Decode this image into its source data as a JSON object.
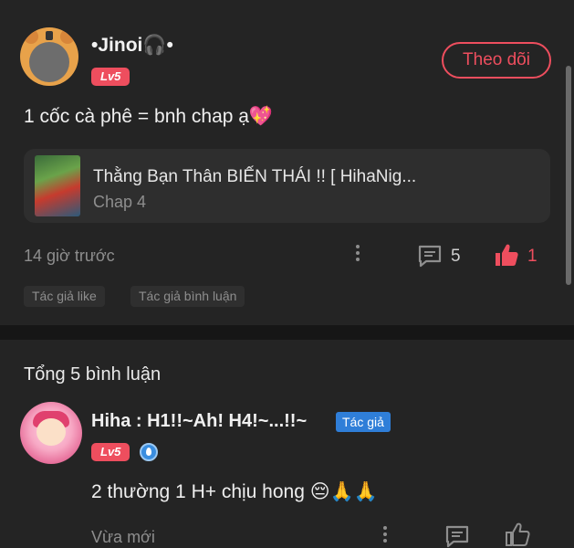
{
  "post": {
    "username": "•Jinoi🎧•",
    "level": "Lv5",
    "follow_label": "Theo dõi",
    "text": "1 cốc cà phê = bnh chap ạ💖",
    "card": {
      "title": "Thằng Bạn Thân BIẾN THÁI !! [ HihaNig...",
      "subtitle": "Chap 4"
    },
    "time": "14 giờ trước",
    "comment_count": "5",
    "like_count": "1",
    "tags": [
      "Tác giả like",
      "Tác giả bình luận"
    ]
  },
  "comments": {
    "title": "Tổng 5 bình luận",
    "items": [
      {
        "name": "Hiha : H1!!~Ah! H4!~...!!~",
        "author_badge": "Tác giả",
        "level": "Lv5",
        "text": "2 thường 1 H+ chịu hong 😔🙏🙏",
        "time": "Vừa mới"
      }
    ]
  },
  "colors": {
    "accent": "#ee4e5e",
    "author_badge": "#2f7ed8",
    "background": "#242424"
  },
  "icons": [
    "tiger-avatar",
    "headphones",
    "more-dots-icon",
    "comment-icon",
    "thumbs-up-icon",
    "vip-drop-icon"
  ]
}
